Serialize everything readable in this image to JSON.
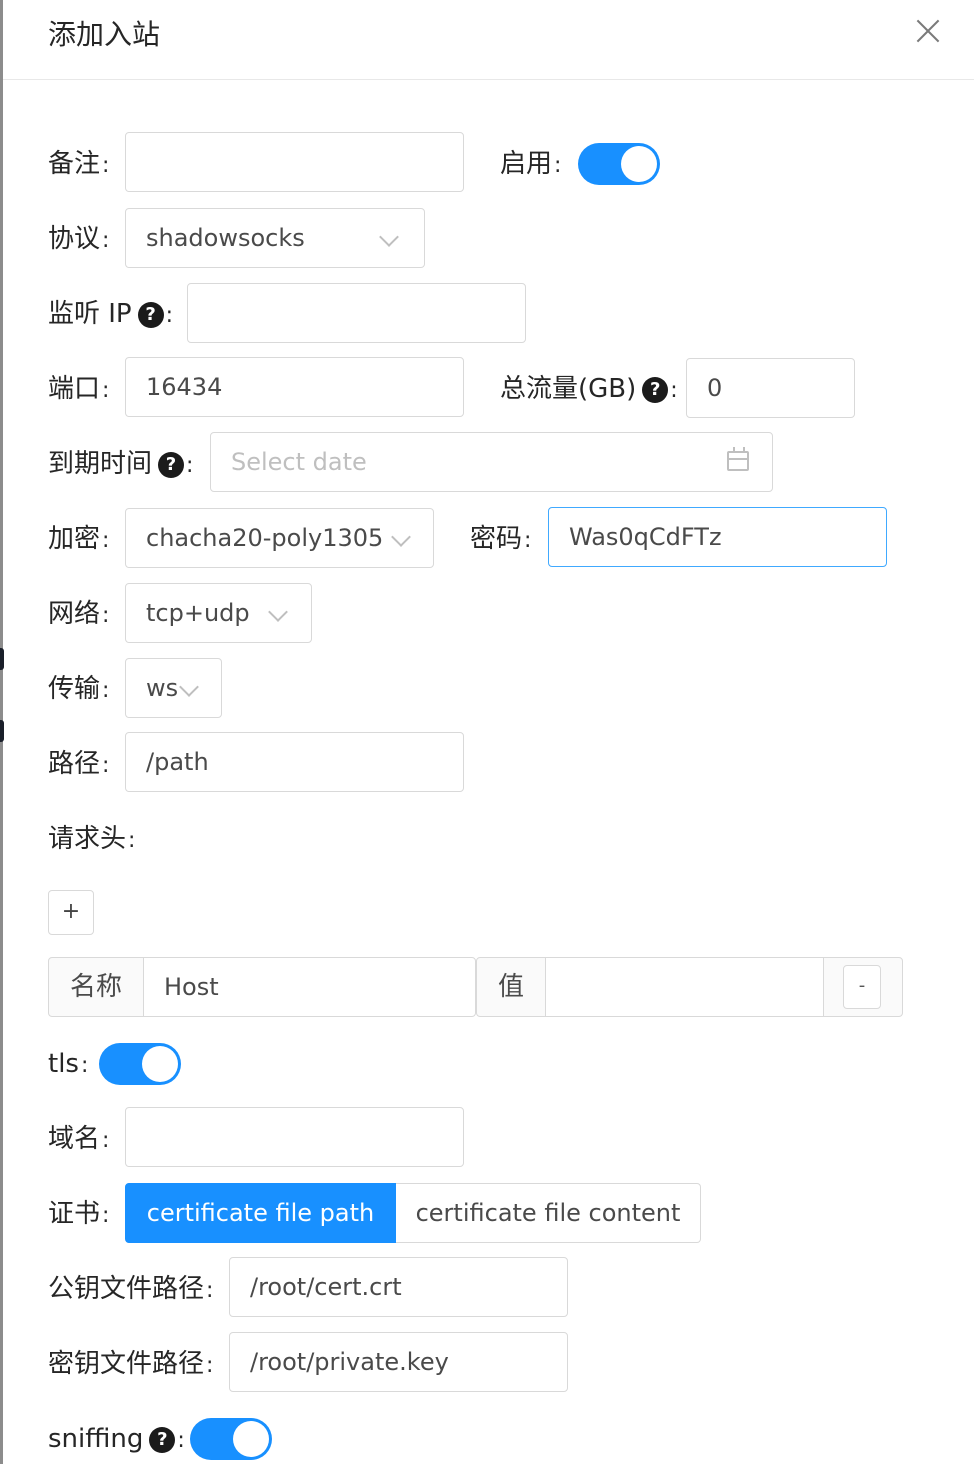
{
  "dialog": {
    "title": "添加入站",
    "close_icon": "close-icon"
  },
  "fields": {
    "remark": {
      "label": "备注",
      "value": ""
    },
    "enable": {
      "label": "启用",
      "checked": true
    },
    "protocol": {
      "label": "协议",
      "value": "shadowsocks"
    },
    "listen_ip": {
      "label": "监听 IP",
      "value": ""
    },
    "port": {
      "label": "端口",
      "value": "16434"
    },
    "total_traffic": {
      "label": "总流量(GB)",
      "value": "0"
    },
    "expiry": {
      "label": "到期时间",
      "placeholder": "Select date"
    },
    "encryption": {
      "label": "加密",
      "value": "chacha20-poly1305"
    },
    "password": {
      "label": "密码",
      "value": "Was0qCdFTz"
    },
    "network": {
      "label": "网络",
      "value": "tcp+udp"
    },
    "transport": {
      "label": "传输",
      "value": "ws"
    },
    "path": {
      "label": "路径",
      "value": "/path"
    },
    "headers": {
      "label": "请求头",
      "add_label": "+",
      "rows": [
        {
          "name_addon": "名称",
          "name": "Host",
          "value_addon": "值",
          "value": "",
          "remove_label": "-"
        }
      ]
    },
    "tls": {
      "label": "tls",
      "checked": true
    },
    "domain": {
      "label": "域名",
      "value": ""
    },
    "certificate": {
      "label": "证书",
      "options": [
        "certificate file path",
        "certificate file content"
      ],
      "selected": "certificate file path"
    },
    "public_key_path": {
      "label": "公钥文件路径",
      "value": "/root/cert.crt"
    },
    "private_key_path": {
      "label": "密钥文件路径",
      "value": "/root/private.key"
    },
    "sniffing": {
      "label": "sniffing",
      "checked": true
    }
  },
  "help_icon_glyph": "?",
  "colon": ":",
  "colors": {
    "primary": "#1890ff",
    "border": "#d9d9d9",
    "focus_border": "#40a9ff",
    "placeholder": "#bfbfbf"
  }
}
